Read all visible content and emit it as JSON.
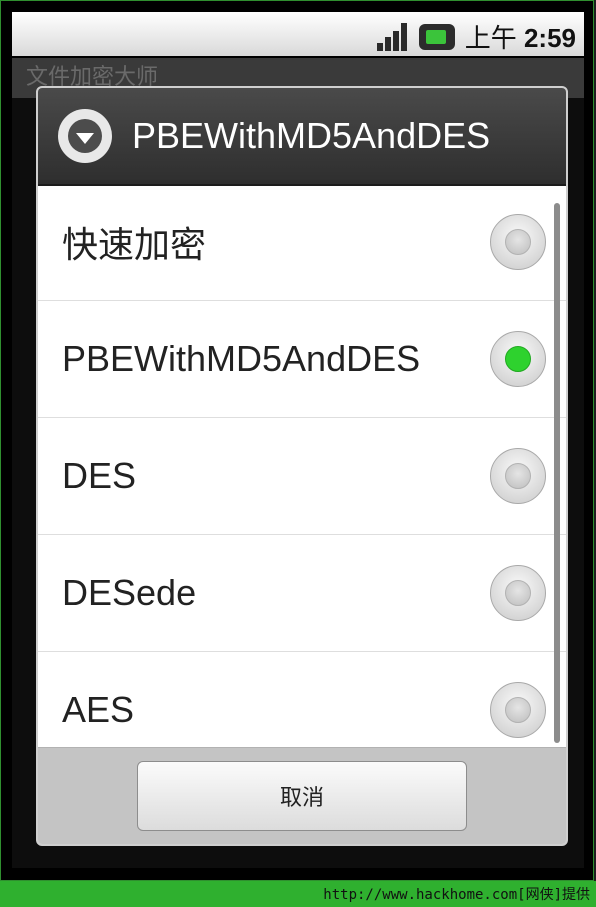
{
  "status_bar": {
    "signal_icon": "signal-icon",
    "battery_icon": "battery-charging-icon",
    "time_prefix": "上午",
    "time": "2:59"
  },
  "app": {
    "title": "文件加密大师"
  },
  "dialog": {
    "title": "PBEWithMD5AndDES",
    "header_icon": "dropdown-circle-icon",
    "items": [
      {
        "label": "快速加密",
        "selected": false
      },
      {
        "label": "PBEWithMD5AndDES",
        "selected": true
      },
      {
        "label": "DES",
        "selected": false
      },
      {
        "label": "DESede",
        "selected": false
      },
      {
        "label": "AES",
        "selected": false
      }
    ],
    "cancel_label": "取消"
  },
  "watermark": "http://www.hackhome.com[网侠]提供",
  "colors": {
    "selected_radio": "#2ed22e",
    "watermark_bar": "#2fb02f",
    "header_bg": "#3a3a3a"
  }
}
